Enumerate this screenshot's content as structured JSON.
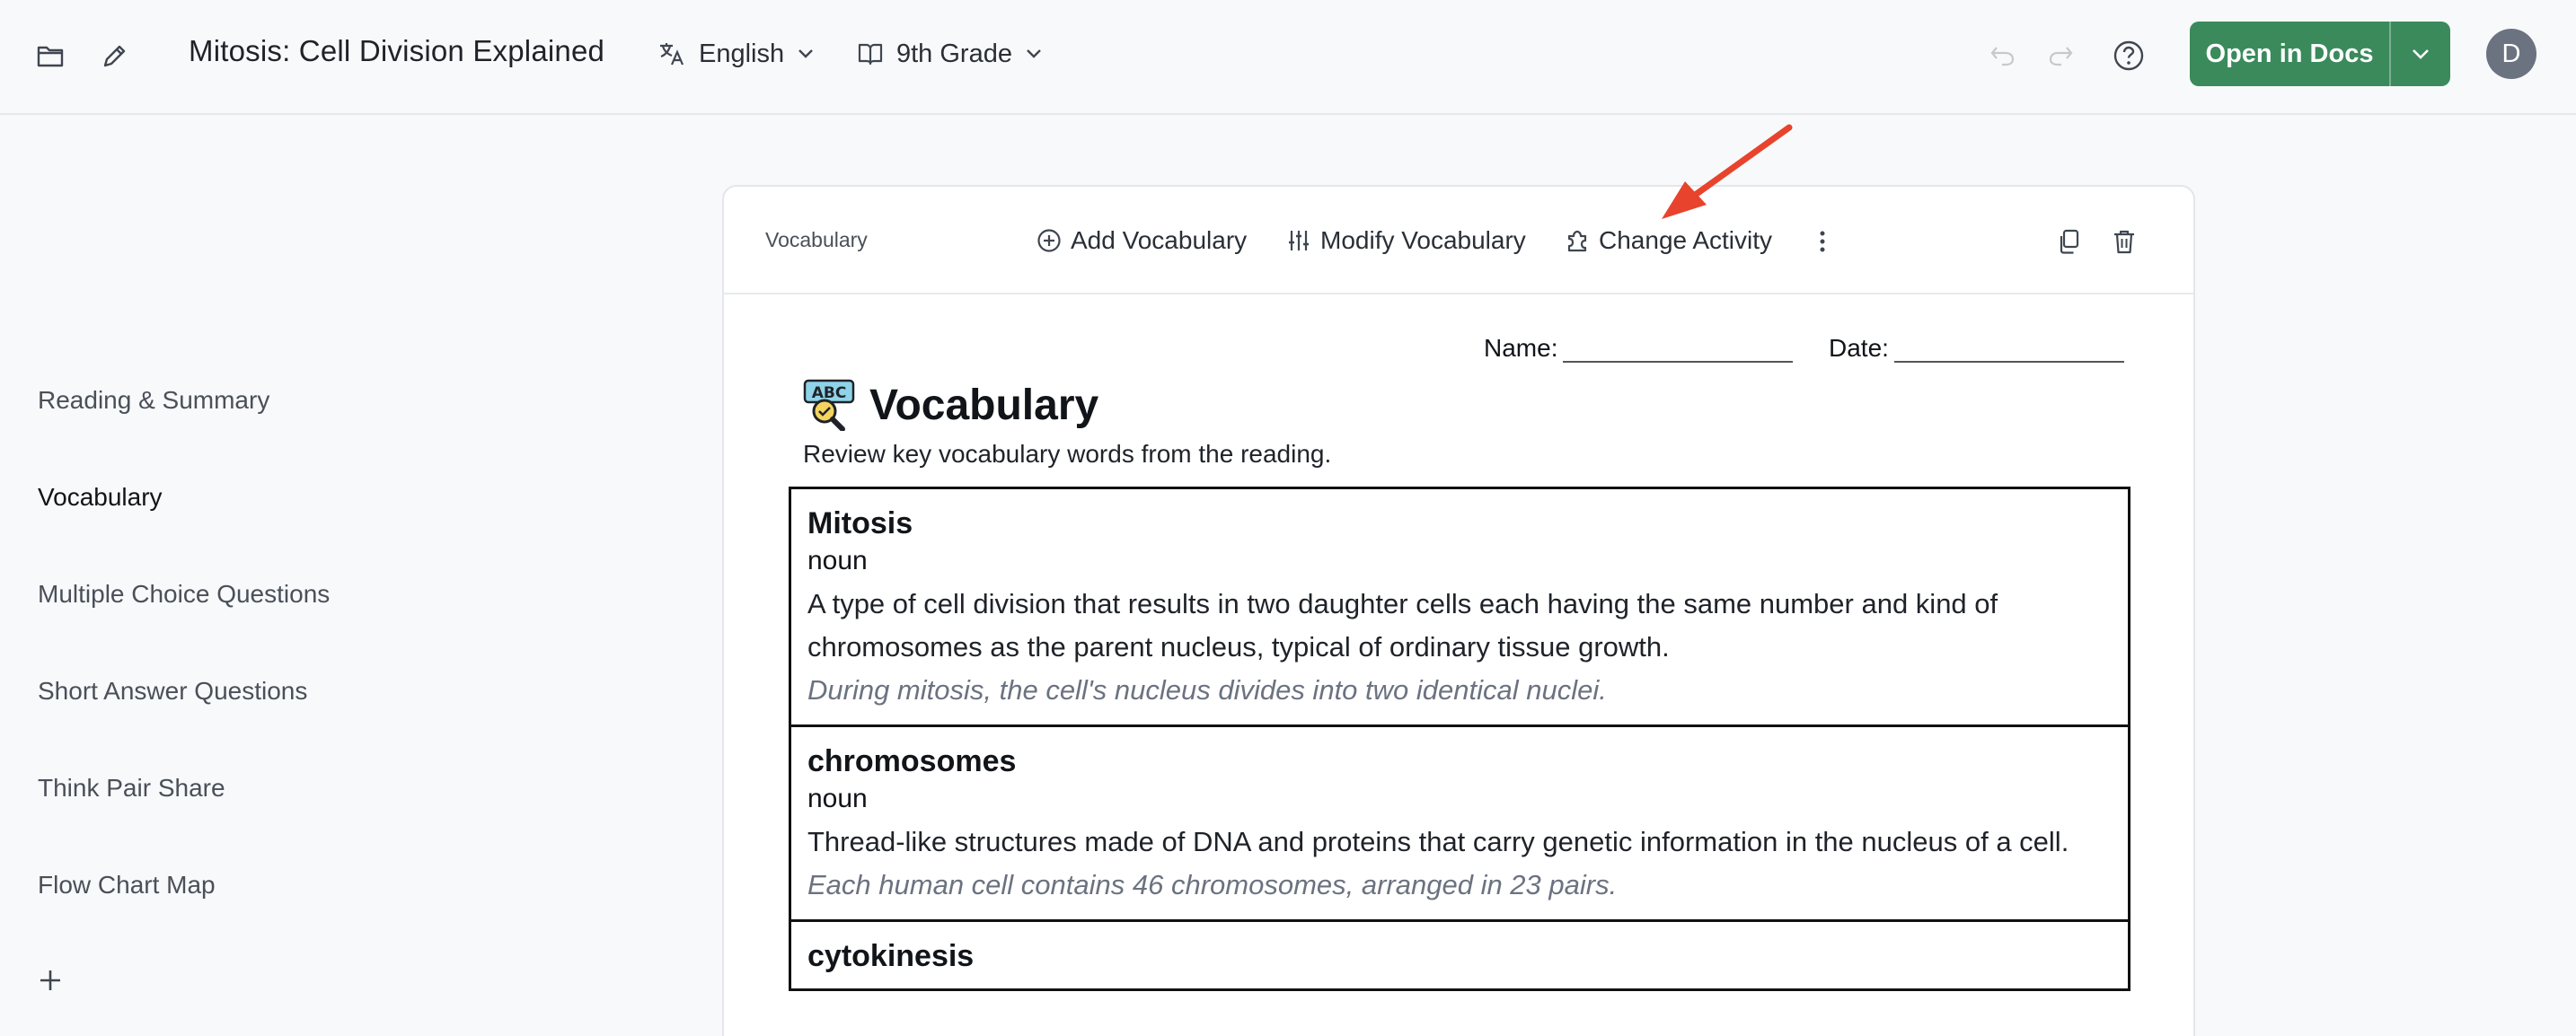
{
  "header": {
    "doc_title": "Mitosis: Cell Division Explained",
    "language": "English",
    "grade": "9th Grade",
    "open_docs_label": "Open in Docs",
    "avatar_initial": "D",
    "accent_color": "#3a8a5c"
  },
  "sidebar": {
    "items": [
      {
        "label": "Reading & Summary"
      },
      {
        "label": "Vocabulary"
      },
      {
        "label": "Multiple Choice Questions"
      },
      {
        "label": "Short Answer Questions"
      },
      {
        "label": "Think Pair Share"
      },
      {
        "label": "Flow Chart Map"
      }
    ],
    "active": "Vocabulary"
  },
  "card": {
    "section_label": "Vocabulary",
    "add_label": "Add Vocabulary",
    "modify_label": "Modify Vocabulary",
    "change_label": "Change Activity"
  },
  "worksheet": {
    "name_label": "Name:",
    "date_label": "Date:",
    "title": "Vocabulary",
    "subtitle": "Review key vocabulary words from the reading.",
    "entries": [
      {
        "term": "Mitosis",
        "pos": "noun",
        "definition": "A type of cell division that results in two daughter cells each having the same number and kind of chromosomes as the parent nucleus, typical of ordinary tissue growth.",
        "example": "During mitosis, the cell's nucleus divides into two identical nuclei."
      },
      {
        "term": "chromosomes",
        "pos": "noun",
        "definition": "Thread-like structures made of DNA and proteins that carry genetic information in the nucleus of a cell.",
        "example": "Each human cell contains 46 chromosomes, arranged in 23 pairs."
      },
      {
        "term": "cytokinesis",
        "pos": "",
        "definition": "",
        "example": ""
      }
    ]
  },
  "annotation": {
    "arrow_color": "#e8432d"
  }
}
